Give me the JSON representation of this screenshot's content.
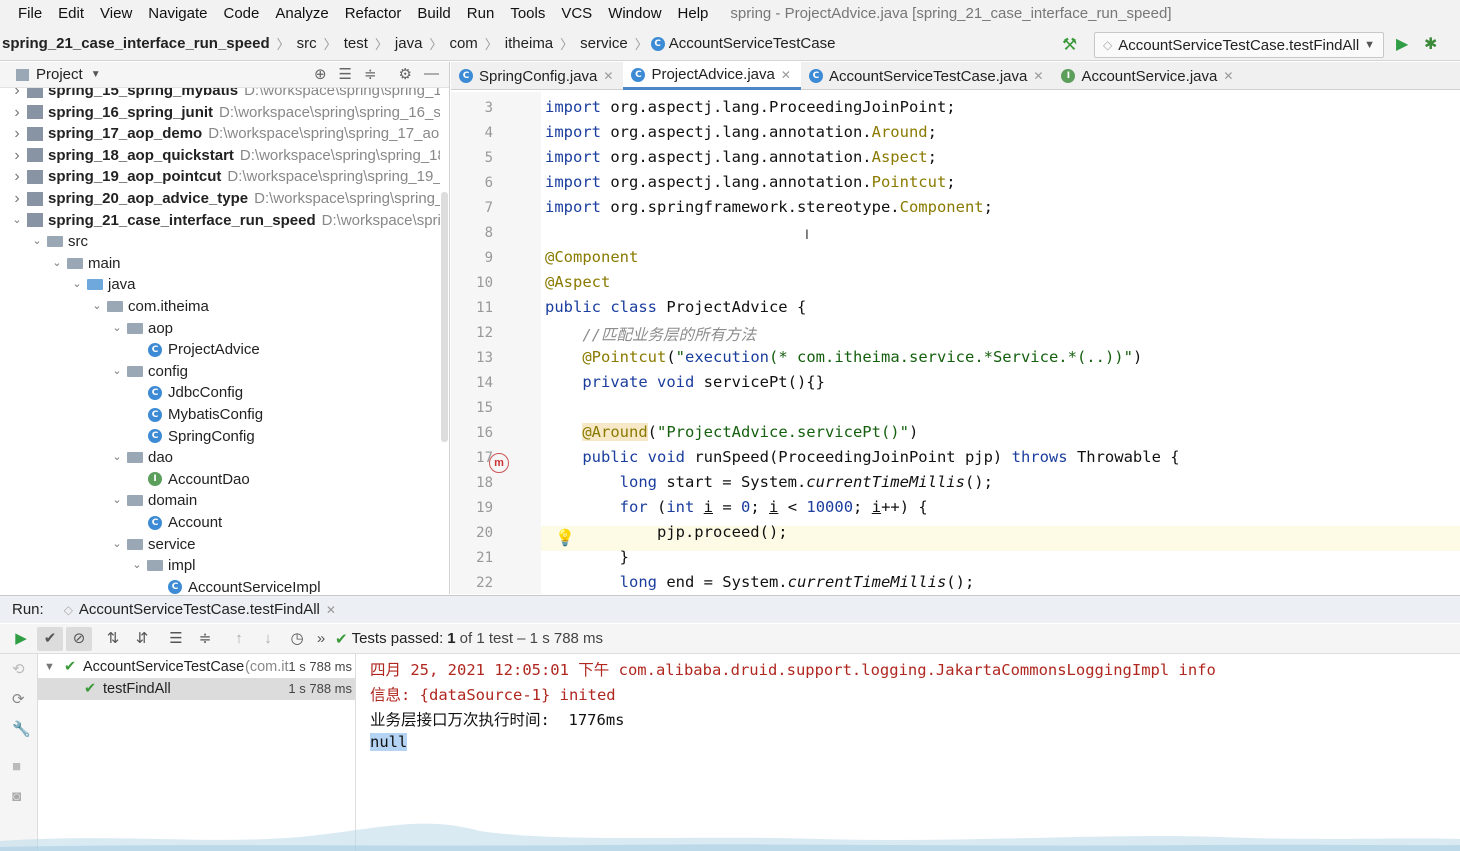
{
  "menu": {
    "items": [
      "File",
      "Edit",
      "View",
      "Navigate",
      "Code",
      "Analyze",
      "Refactor",
      "Build",
      "Run",
      "Tools",
      "VCS",
      "Window",
      "Help"
    ],
    "window_title": "spring - ProjectAdvice.java [spring_21_case_interface_run_speed]"
  },
  "breadcrumb": {
    "items": [
      "spring_21_case_interface_run_speed",
      "src",
      "test",
      "java",
      "com",
      "itheima",
      "service",
      "AccountServiceTestCase"
    ]
  },
  "run_config": {
    "label": "AccountServiceTestCase.testFindAll"
  },
  "project": {
    "title": "Project",
    "tree": [
      {
        "label": "spring_15_spring_mybatis",
        "path": "D:\\workspace\\spring\\spring_15_s",
        "level": 0,
        "arrow": ">",
        "type": "module"
      },
      {
        "label": "spring_16_spring_junit",
        "path": "D:\\workspace\\spring\\spring_16_spr",
        "level": 0,
        "arrow": ">",
        "type": "module"
      },
      {
        "label": "spring_17_aop_demo",
        "path": "D:\\workspace\\spring\\spring_17_aop_",
        "level": 0,
        "arrow": ">",
        "type": "module"
      },
      {
        "label": "spring_18_aop_quickstart",
        "path": "D:\\workspace\\spring\\spring_18_",
        "level": 0,
        "arrow": ">",
        "type": "module"
      },
      {
        "label": "spring_19_aop_pointcut",
        "path": "D:\\workspace\\spring\\spring_19_ac",
        "level": 0,
        "arrow": ">",
        "type": "module"
      },
      {
        "label": "spring_20_aop_advice_type",
        "path": "D:\\workspace\\spring\\spring_2(",
        "level": 0,
        "arrow": ">",
        "type": "module"
      },
      {
        "label": "spring_21_case_interface_run_speed",
        "path": "D:\\workspace\\spring\\",
        "level": 0,
        "arrow": "v",
        "type": "module"
      },
      {
        "label": "src",
        "path": "",
        "level": 1,
        "arrow": "v",
        "type": "folder"
      },
      {
        "label": "main",
        "path": "",
        "level": 2,
        "arrow": "v",
        "type": "folder"
      },
      {
        "label": "java",
        "path": "",
        "level": 3,
        "arrow": "v",
        "type": "folder-blue"
      },
      {
        "label": "com.itheima",
        "path": "",
        "level": 4,
        "arrow": "v",
        "type": "folder"
      },
      {
        "label": "aop",
        "path": "",
        "level": 5,
        "arrow": "v",
        "type": "folder"
      },
      {
        "label": "ProjectAdvice",
        "path": "",
        "level": 6,
        "arrow": "",
        "type": "class"
      },
      {
        "label": "config",
        "path": "",
        "level": 5,
        "arrow": "v",
        "type": "folder"
      },
      {
        "label": "JdbcConfig",
        "path": "",
        "level": 6,
        "arrow": "",
        "type": "class"
      },
      {
        "label": "MybatisConfig",
        "path": "",
        "level": 6,
        "arrow": "",
        "type": "class"
      },
      {
        "label": "SpringConfig",
        "path": "",
        "level": 6,
        "arrow": "",
        "type": "class"
      },
      {
        "label": "dao",
        "path": "",
        "level": 5,
        "arrow": "v",
        "type": "folder"
      },
      {
        "label": "AccountDao",
        "path": "",
        "level": 6,
        "arrow": "",
        "type": "interface"
      },
      {
        "label": "domain",
        "path": "",
        "level": 5,
        "arrow": "v",
        "type": "folder"
      },
      {
        "label": "Account",
        "path": "",
        "level": 6,
        "arrow": "",
        "type": "class"
      },
      {
        "label": "service",
        "path": "",
        "level": 5,
        "arrow": "v",
        "type": "folder"
      },
      {
        "label": "impl",
        "path": "",
        "level": 6,
        "arrow": "v",
        "type": "folder"
      },
      {
        "label": "AccountServiceImpl",
        "path": "",
        "level": 7,
        "arrow": "",
        "type": "class"
      }
    ]
  },
  "editor": {
    "tabs": [
      {
        "label": "SpringConfig.java",
        "icon": "C",
        "active": false
      },
      {
        "label": "ProjectAdvice.java",
        "icon": "C",
        "active": true
      },
      {
        "label": "AccountServiceTestCase.java",
        "icon": "C",
        "active": false
      },
      {
        "label": "AccountService.java",
        "icon": "I",
        "active": false
      }
    ],
    "lines": [
      {
        "n": "3",
        "html": "<span class='kw'>import</span> org.aspectj.lang.ProceedingJoinPoint;"
      },
      {
        "n": "4",
        "html": "<span class='kw'>import</span> org.aspectj.lang.annotation.<span class='ann'>Around</span>;"
      },
      {
        "n": "5",
        "html": "<span class='kw'>import</span> org.aspectj.lang.annotation.<span class='ann'>Aspect</span>;"
      },
      {
        "n": "6",
        "html": "<span class='kw'>import</span> org.aspectj.lang.annotation.<span class='ann'>Pointcut</span>;"
      },
      {
        "n": "7",
        "html": "<span class='kw'>import</span> org.springframework.stereotype.<span class='ann'>Component</span>;"
      },
      {
        "n": "8",
        "html": ""
      },
      {
        "n": "9",
        "html": "<span class='ann'>@Component</span>"
      },
      {
        "n": "10",
        "html": "<span class='ann'>@Aspect</span>"
      },
      {
        "n": "11",
        "html": "<span class='kw'>public class</span> ProjectAdvice {"
      },
      {
        "n": "12",
        "html": "    <span class='cmt'>//匹配业务层的所有方法</span>"
      },
      {
        "n": "13",
        "html": "    <span class='ann'>@Pointcut</span>(<span class='str'>\"<b style='font-weight:normal;color:#1a3d9e'>execution</b>(* com.itheima.service.*Service.*(..))\"</span>)"
      },
      {
        "n": "14",
        "html": "    <span class='kw'>private void</span> servicePt(){}"
      },
      {
        "n": "15",
        "html": ""
      },
      {
        "n": "16",
        "html": "    <span class='ann' style='background:#f7e9c8'>@Around</span>(<span class='str'>\"ProjectAdvice.servicePt()\"</span>)"
      },
      {
        "n": "17",
        "html": "    <span class='kw'>public void</span> runSpeed(ProceedingJoinPoint pjp) <span class='kw'>throws</span> Throwable {"
      },
      {
        "n": "18",
        "html": "        <span class='kw'>long</span> start = System.<span class='it'>currentTimeMillis</span>();"
      },
      {
        "n": "19",
        "html": "        <span class='kw'>for</span> (<span class='kw'>int</span> <u>i</u> = <span class='num'>0</span>; <u>i</u> &lt; <span class='num'>10000</span>; <u>i</u>++) {"
      },
      {
        "n": "20",
        "html": "            pjp.proceed();"
      },
      {
        "n": "21",
        "html": "        }"
      },
      {
        "n": "22",
        "html": "        <span class='kw'>long</span> end = System.<span class='it'>currentTimeMillis</span>();"
      }
    ]
  },
  "run": {
    "label": "Run:",
    "tab": "AccountServiceTestCase.testFindAll",
    "tests_passed": "Tests passed:",
    "tests_count": "1",
    "tests_of": "of 1 test – 1 s 788 ms",
    "tree": [
      {
        "label": "AccountServiceTestCase",
        "detail": "(com.it",
        "time": "1 s 788 ms"
      },
      {
        "label": "testFindAll",
        "detail": "",
        "time": "1 s 788 ms"
      }
    ],
    "console": [
      {
        "text": "四月 25, 2021 12:05:01 下午 com.alibaba.druid.support.logging.JakartaCommonsLoggingImpl info",
        "kind": "err"
      },
      {
        "text": "信息: {dataSource-1} inited",
        "kind": "err"
      },
      {
        "text": "业务层接口万次执行时间:  1776ms",
        "kind": "out"
      },
      {
        "text": "null",
        "kind": "sel"
      }
    ]
  },
  "colors": {
    "accent": "#4a86c8",
    "keyword": "#1a3d9e",
    "annotation": "#8a7a00",
    "string": "#14600e",
    "error_text": "#b0271f"
  }
}
